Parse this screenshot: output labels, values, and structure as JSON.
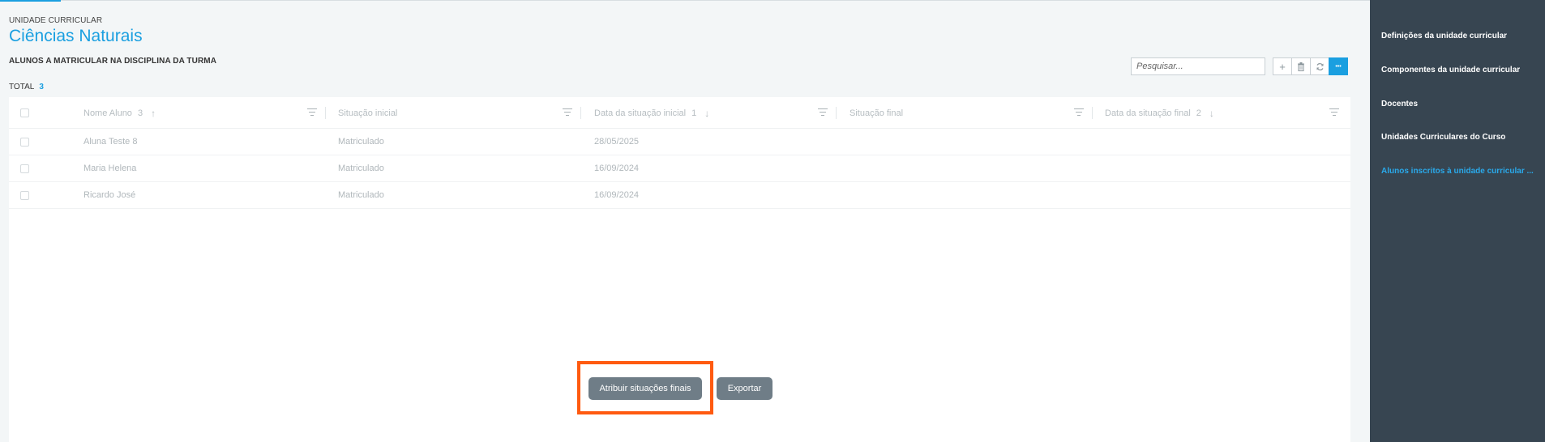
{
  "header": {
    "eyebrow": "UNIDADE CURRICULAR",
    "title": "Ciências Naturais"
  },
  "section": {
    "title": "ALUNOS A MATRICULAR NA DISCIPLINA DA TURMA",
    "total_label": "TOTAL",
    "total_count": "3"
  },
  "toolbar": {
    "search_placeholder": "Pesquisar...",
    "add_icon": "plus-icon",
    "delete_icon": "trash-icon",
    "refresh_icon": "refresh-icon",
    "more_icon": "more-icon",
    "add_glyph": "+",
    "more_glyph": "•••"
  },
  "table": {
    "columns": [
      {
        "label": "Nome Aluno",
        "sort_order": "3",
        "sort_dir": "↑"
      },
      {
        "label": "Situação inicial",
        "sort_order": "",
        "sort_dir": ""
      },
      {
        "label": "Data da situação inicial",
        "sort_order": "1",
        "sort_dir": "↓"
      },
      {
        "label": "Situação final",
        "sort_order": "",
        "sort_dir": ""
      },
      {
        "label": "Data da situação final",
        "sort_order": "2",
        "sort_dir": "↓"
      }
    ],
    "rows": [
      {
        "name": "Aluna Teste 8",
        "situacao_inicial": "Matriculado",
        "data_inicial": "28/05/2025",
        "situacao_final": "",
        "data_final": ""
      },
      {
        "name": "Maria Helena",
        "situacao_inicial": "Matriculado",
        "data_inicial": "16/09/2024",
        "situacao_final": "",
        "data_final": ""
      },
      {
        "name": "Ricardo José",
        "situacao_inicial": "Matriculado",
        "data_inicial": "16/09/2024",
        "situacao_final": "",
        "data_final": ""
      }
    ]
  },
  "actions": {
    "assign_label": "Atribuir situações finais",
    "export_label": "Exportar"
  },
  "sidebar": {
    "items": [
      {
        "label": "Definições da unidade curricular",
        "active": false
      },
      {
        "label": "Componentes da unidade curricular",
        "active": false
      },
      {
        "label": "Docentes",
        "active": false
      },
      {
        "label": "Unidades Curriculares do Curso",
        "active": false
      },
      {
        "label": "Alunos inscritos à unidade curricular ...",
        "active": true
      }
    ]
  },
  "colors": {
    "accent": "#1a9fe0",
    "sidebar_bg": "#374551",
    "button_grey": "#6f7d87",
    "highlight": "#ff5a10"
  }
}
